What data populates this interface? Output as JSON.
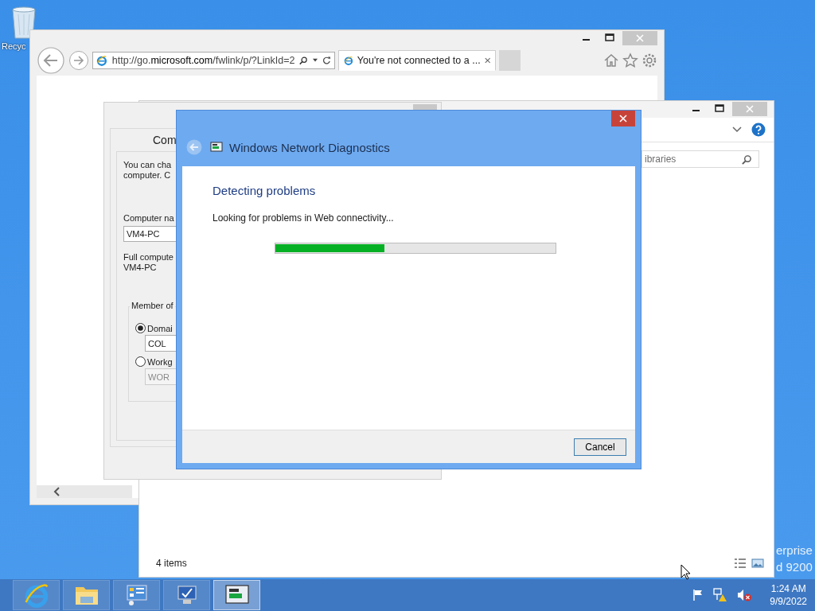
{
  "desktop": {
    "icons": [
      {
        "label": "Recyc"
      }
    ],
    "watermark_lines": [
      "erprise",
      "d 9200"
    ]
  },
  "browser": {
    "address": "http://go.**microsoft.com**/fwlink/p/?LinkId=2",
    "tabs": [
      {
        "title": "You're not connected to a ...",
        "selected": true
      }
    ]
  },
  "system_properties": {
    "tab": "Com",
    "intro_lines": [
      "You can cha",
      "computer. C"
    ],
    "computer_name_label": "Computer na",
    "computer_name": "VM4-PC",
    "full_name_label": "Full compute",
    "full_name": "VM4-PC",
    "member_of_label": "Member of",
    "options": [
      {
        "label": "Domai",
        "selected": true,
        "value": "COL"
      },
      {
        "label": "Workg",
        "selected": false,
        "value": "WOR"
      }
    ]
  },
  "explorer": {
    "search_placeholder": "ibraries",
    "status": "4 items"
  },
  "dialog": {
    "title": "Windows Network Diagnostics",
    "heading": "Detecting problems",
    "message": "Looking for problems in Web connectivity...",
    "progress": {
      "level": 0.39
    },
    "buttons": [
      "Cancel"
    ]
  },
  "taskbar": {
    "apps": [
      {
        "kind": "browser",
        "selected": false
      },
      {
        "kind": "folder",
        "selected": false
      },
      {
        "kind": "control-panel",
        "selected": false
      },
      {
        "kind": "monitor",
        "selected": false
      },
      {
        "kind": "network",
        "selected": true
      }
    ],
    "clock": {
      "time": "1:24 AM",
      "date": "9/9/2022"
    }
  }
}
